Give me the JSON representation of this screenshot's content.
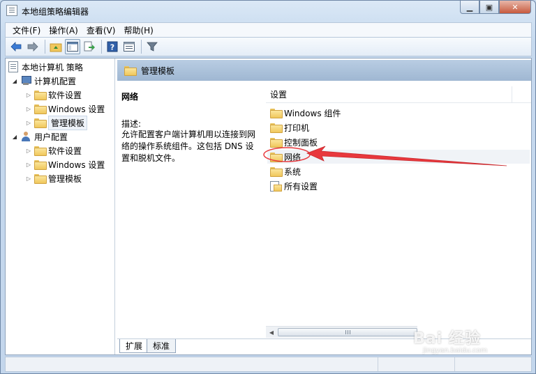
{
  "window": {
    "title": "本地组策略编辑器"
  },
  "menu": [
    "文件(F)",
    "操作(A)",
    "查看(V)",
    "帮助(H)"
  ],
  "toolbar": {
    "buttons": [
      "back-arrow-icon",
      "forward-arrow-icon",
      "up-folder-icon",
      "show-hide-tree-icon",
      "export-list-icon",
      "help-icon",
      "properties-icon",
      "filter-icon"
    ]
  },
  "tree": {
    "root": "本地计算机 策略",
    "computer": {
      "label": "计算机配置",
      "children": [
        "软件设置",
        "Windows 设置",
        "管理模板"
      ]
    },
    "user": {
      "label": "用户配置",
      "children": [
        "软件设置",
        "Windows 设置",
        "管理模板"
      ]
    }
  },
  "header": {
    "title": "管理模板"
  },
  "description": {
    "title": "网络",
    "label": "描述:",
    "text": "允许配置客户端计算机用以连接到网络的操作系统组件。这包括 DNS 设置和脱机文件。"
  },
  "list": {
    "column": "设置",
    "items": [
      "Windows 组件",
      "打印机",
      "控制面板",
      "网络",
      "系统",
      "所有设置"
    ]
  },
  "tabs": [
    "扩展",
    "标准"
  ],
  "watermark": {
    "main": "Bai 经验",
    "sub": "jingyan.baidu.com"
  },
  "colors": {
    "annotation": "#e8383d",
    "header_band": "#a8bed8"
  }
}
